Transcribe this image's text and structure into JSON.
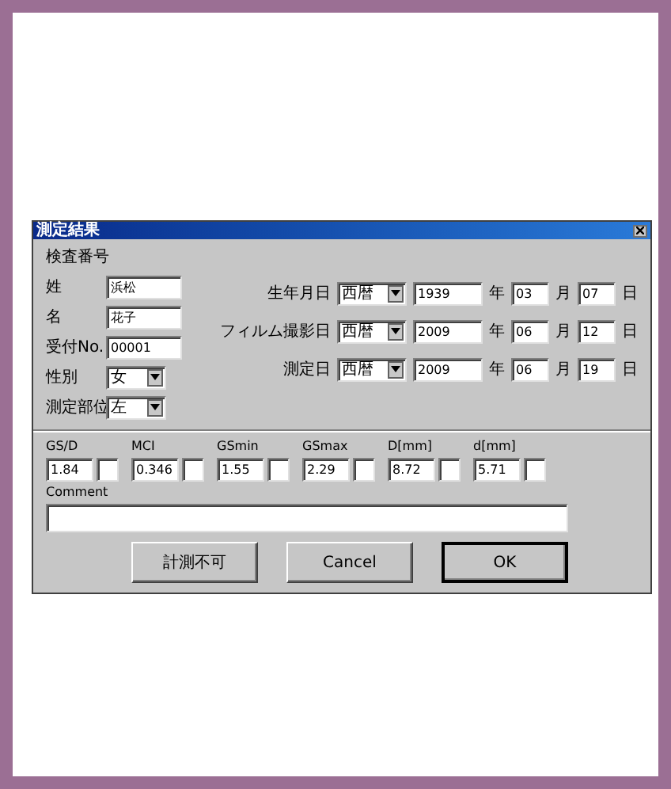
{
  "window": {
    "title": "測定結果"
  },
  "exam_number_label": "検査番号",
  "left_fields": [
    {
      "label": "姓",
      "kind": "text",
      "value": "浜松"
    },
    {
      "label": "名",
      "kind": "text",
      "value": "花子"
    },
    {
      "label": "受付No.",
      "kind": "text",
      "value": "00001"
    },
    {
      "label": "性別",
      "kind": "select",
      "value": "女"
    },
    {
      "label": "測定部位",
      "kind": "select",
      "value": "左"
    }
  ],
  "date_fields": [
    {
      "label": "生年月日",
      "era": "西暦",
      "year": "1939",
      "year_unit": "年",
      "month": "03",
      "month_unit": "月",
      "day": "07",
      "day_unit": "日"
    },
    {
      "label": "フィルム撮影日",
      "era": "西暦",
      "year": "2009",
      "year_unit": "年",
      "month": "06",
      "month_unit": "月",
      "day": "12",
      "day_unit": "日"
    },
    {
      "label": "測定日",
      "era": "西暦",
      "year": "2009",
      "year_unit": "年",
      "month": "06",
      "month_unit": "月",
      "day": "19",
      "day_unit": "日"
    }
  ],
  "measurements": [
    {
      "label": "GS/D",
      "value": "1.84"
    },
    {
      "label": "MCI",
      "value": "0.346"
    },
    {
      "label": "GSmin",
      "value": "1.55"
    },
    {
      "label": "GSmax",
      "value": "2.29"
    },
    {
      "label": "D[mm]",
      "value": "8.72"
    },
    {
      "label": "d[mm]",
      "value": "5.71"
    }
  ],
  "comment": {
    "label": "Comment"
  },
  "buttons": [
    {
      "label": "計測不可",
      "default": false
    },
    {
      "label": "Cancel",
      "default": false
    },
    {
      "label": "OK",
      "default": true
    }
  ]
}
